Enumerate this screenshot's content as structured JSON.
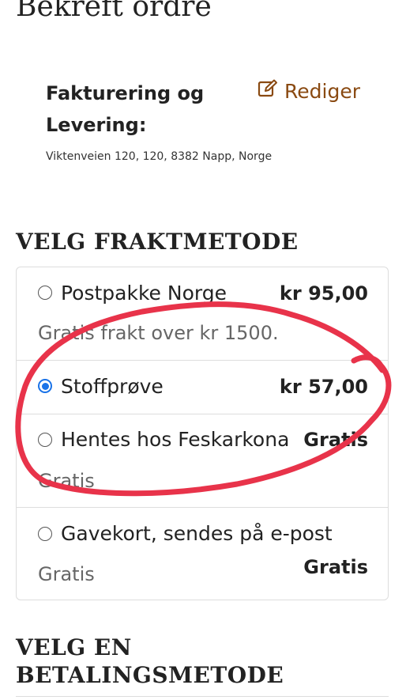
{
  "page": {
    "title": "Bekreft ordre"
  },
  "billing": {
    "title": "Fakturering og Levering:",
    "edit_label": "Rediger",
    "edit_icon": "edit-icon",
    "address": "Viktenveien 120, 120, 8382 Napp, Norge"
  },
  "shipping": {
    "heading": "VELG FRAKTMETODE",
    "options": [
      {
        "name": "Postpakke Norge",
        "price": "kr 95,00",
        "description": "Gratis frakt over kr 1500.",
        "selected": false
      },
      {
        "name": "Stoffprøve",
        "price": "kr 57,00",
        "description": "",
        "selected": true
      },
      {
        "name": "Hentes hos Feskarkona",
        "price": "Gratis",
        "description": "Gratis",
        "selected": false
      },
      {
        "name": "Gavekort, sendes på e-post",
        "price": "Gratis",
        "description": "Gratis",
        "selected": false
      }
    ]
  },
  "payment": {
    "heading_line1": "VELG EN",
    "heading_line2": "BETALINGSMETODE"
  },
  "colors": {
    "accent_link": "#8a4a12",
    "radio_selected": "#1a73e8",
    "annotation": "#e8334a"
  }
}
